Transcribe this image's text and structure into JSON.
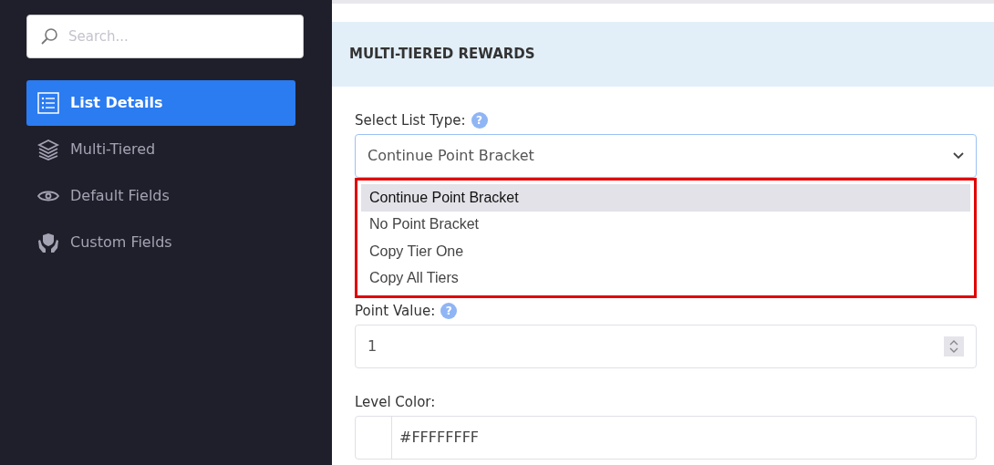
{
  "sidebar": {
    "search": {
      "placeholder": "Search..."
    },
    "items": [
      {
        "label": "List Details",
        "selected": true
      },
      {
        "label": "Multi-Tiered",
        "selected": false
      },
      {
        "label": "Default Fields",
        "selected": false
      },
      {
        "label": "Custom Fields",
        "selected": false
      }
    ]
  },
  "section": {
    "title": "MULTI-TIERED REWARDS"
  },
  "list_type": {
    "label": "Select List Type:",
    "help": "?",
    "value": "Continue Point Bracket",
    "expanded": true,
    "options": [
      {
        "label": "Continue Point Bracket",
        "selected": true
      },
      {
        "label": "No Point Bracket",
        "selected": false
      },
      {
        "label": "Copy Tier One",
        "selected": false
      },
      {
        "label": "Copy All Tiers",
        "selected": false
      }
    ]
  },
  "point_value": {
    "label": "Point Value:",
    "help": "?",
    "value": "1"
  },
  "level_color": {
    "label": "Level Color:",
    "value": "#FFFFFFFF"
  }
}
